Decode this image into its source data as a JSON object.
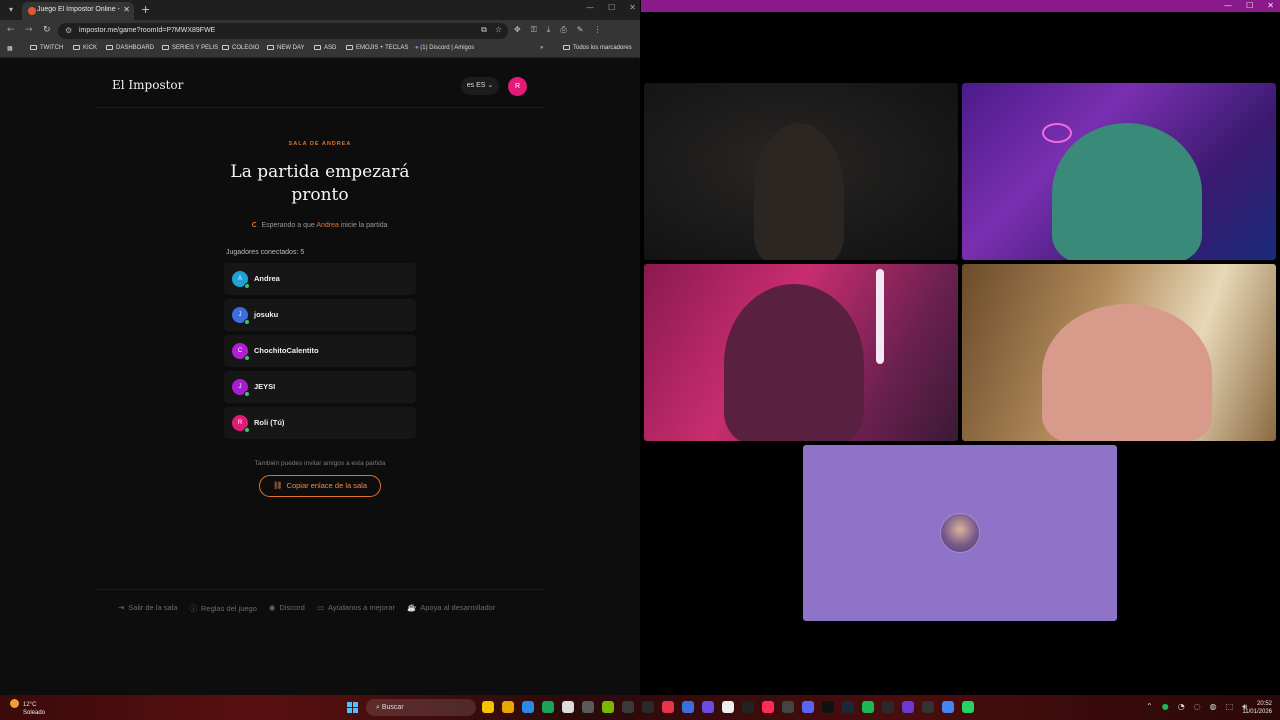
{
  "browser": {
    "tab_title": "Juego El Impostor Online - Jueg",
    "url": "impostor.me/game?roomId=P7MWX89FWE",
    "bookmarks": [
      "TWITCH",
      "KICK",
      "DASHBOARD",
      "SERIES Y PELIS",
      "COLEGIO",
      "NEW DAY",
      "ASD",
      "EMOJIS + TECLAS",
      "(1) Discord | Amigos",
      "Todos los marcadores"
    ]
  },
  "page": {
    "brand": "El Impostor",
    "lang": "ES",
    "lang_prefix": "es",
    "user_initial": "R",
    "room_label": "SALA DE ANDREA",
    "headline": "La partida empezará pronto",
    "waiting_pre": "Esperando a que",
    "waiting_host": "Andrea",
    "waiting_post": "inicie la partida",
    "players_title": "Jugadores conectados: 5",
    "players": [
      {
        "initial": "A",
        "name": "Andrea",
        "color": "#1fa2d8"
      },
      {
        "initial": "J",
        "name": "josuku",
        "color": "#3b6fe0"
      },
      {
        "initial": "C",
        "name": "ChochitoCalentito",
        "color": "#b21fd1"
      },
      {
        "initial": "J",
        "name": "JEYSI",
        "color": "#a51fd1"
      },
      {
        "initial": "R",
        "name": "Roli (Tú)",
        "color": "#e21b78"
      }
    ],
    "invite_text": "También puedes invitar amigos a esta partida",
    "copy_button": "Copiar enlace de la sala",
    "footer": [
      "Salir de la sala",
      "Reglas del juego",
      "Discord",
      "Ayúdanos a mejorar",
      "Apoya al desarrollador"
    ]
  },
  "taskbar": {
    "temp": "12°C",
    "weather": "Soleado",
    "search": "Buscar",
    "time": "20:52",
    "date": "11/01/2026"
  },
  "colors": {
    "accent": "#e0732b",
    "online": "#3ec46d",
    "call_bar": "#8a1a8a",
    "tile_idle": "#8f73c8"
  }
}
